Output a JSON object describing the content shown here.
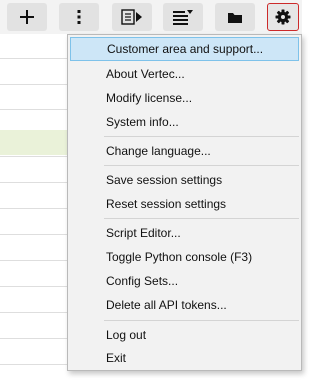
{
  "toolbar": {
    "buttons": [
      {
        "name": "add",
        "icon": "plus-icon"
      },
      {
        "name": "more",
        "icon": "vertical-dots-icon"
      },
      {
        "name": "document-arrow",
        "icon": "document-arrow-icon"
      },
      {
        "name": "list-dropdown",
        "icon": "list-dropdown-icon"
      },
      {
        "name": "folder",
        "icon": "folder-icon"
      },
      {
        "name": "settings",
        "icon": "gear-icon",
        "active": true
      }
    ],
    "active_border_color": "#cc2a2a"
  },
  "menu": {
    "hover_color": "#cde6f7",
    "items": [
      {
        "label": "Customer area and support...",
        "hover": true
      },
      {
        "label": "About Vertec..."
      },
      {
        "label": "Modify license..."
      },
      {
        "label": "System info..."
      },
      {
        "separator": true
      },
      {
        "label": "Change language..."
      },
      {
        "separator": true
      },
      {
        "label": "Save session settings"
      },
      {
        "label": "Reset session settings"
      },
      {
        "separator": true
      },
      {
        "label": "Script Editor..."
      },
      {
        "label": "Toggle Python console (F3)"
      },
      {
        "label": "Config Sets..."
      },
      {
        "label": "Delete all API tokens..."
      },
      {
        "separator": true
      },
      {
        "label": "Log out"
      },
      {
        "label": "Exit"
      }
    ]
  }
}
